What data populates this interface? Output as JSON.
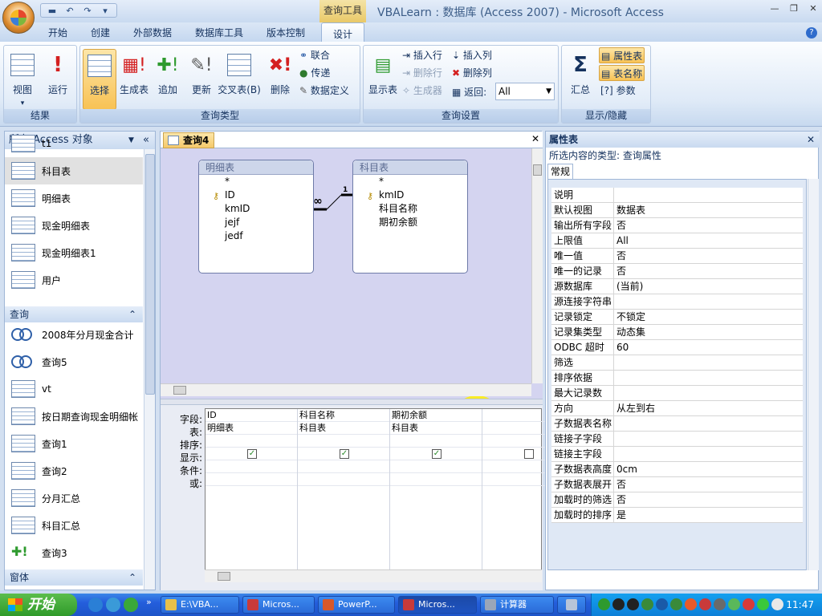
{
  "window": {
    "context_tab": "查询工具",
    "title": "VBALearn : 数据库 (Access 2007) - Microsoft Access"
  },
  "tabs": [
    "开始",
    "创建",
    "外部数据",
    "数据库工具",
    "版本控制",
    "设计"
  ],
  "ribbon": {
    "groups": {
      "results": "结果",
      "query_type": "查询类型",
      "query_setup": "查询设置",
      "show_hide": "显示/隐藏"
    },
    "results": {
      "view": "视图",
      "run": "运行"
    },
    "query_type": {
      "select": "选择",
      "make_table": "生成表",
      "append": "追加",
      "update": "更新",
      "crosstab": "交叉表(B)",
      "delete": "删除",
      "union": "联合",
      "passthrough": "传递",
      "data_definition": "数据定义"
    },
    "query_setup": {
      "show_table": "显示表",
      "insert_rows": "插入行",
      "delete_rows": "删除行",
      "builder": "生成器",
      "insert_columns": "插入列",
      "delete_columns": "删除列",
      "return_label": "返回:",
      "return_value": "All"
    },
    "show_hide": {
      "totals": "汇总",
      "property_sheet": "属性表",
      "table_names": "表名称",
      "parameters": "参数"
    }
  },
  "nav": {
    "header": "所有 Access 对象",
    "tables": [
      "t1",
      "科目表",
      "明细表",
      "现金明细表",
      "现金明细表1",
      "用户"
    ],
    "selected_table": 1,
    "queries_section": "查询",
    "queries": [
      "2008年分月现金合计",
      "查询5",
      "vt",
      "按日期查询现金明细帐",
      "查询1",
      "查询2",
      "分月汇总",
      "科目汇总",
      "查询3"
    ],
    "forms_section": "窗体"
  },
  "query": {
    "tab_label": "查询4",
    "tables": [
      {
        "name": "明细表",
        "fields": [
          "*",
          "ID",
          "kmID",
          "jejf",
          "jedf"
        ],
        "key": 1
      },
      {
        "name": "科目表",
        "fields": [
          "*",
          "kmID",
          "科目名称",
          "期初余额"
        ],
        "key": 1
      }
    ],
    "join": {
      "left_symbol": "∞",
      "right_symbol": "1"
    },
    "grid": {
      "row_labels": [
        "字段:",
        "表:",
        "排序:",
        "显示:",
        "条件:",
        "或:"
      ],
      "columns": [
        {
          "field": "ID",
          "table": "明细表",
          "show": true
        },
        {
          "field": "科目名称",
          "table": "科目表",
          "show": true
        },
        {
          "field": "期初余额",
          "table": "科目表",
          "show": true
        },
        {
          "field": "",
          "table": "",
          "show": false
        }
      ]
    }
  },
  "props": {
    "header": "属性表",
    "selection_label": "所选内容的类型: 查询属性",
    "tab": "常规",
    "rows": [
      [
        "说明",
        ""
      ],
      [
        "默认视图",
        "数据表"
      ],
      [
        "输出所有字段",
        "否"
      ],
      [
        "上限值",
        "All"
      ],
      [
        "唯一值",
        "否"
      ],
      [
        "唯一的记录",
        "否"
      ],
      [
        "源数据库",
        "(当前)"
      ],
      [
        "源连接字符串",
        ""
      ],
      [
        "记录锁定",
        "不锁定"
      ],
      [
        "记录集类型",
        "动态集"
      ],
      [
        "ODBC 超时",
        "60"
      ],
      [
        "筛选",
        ""
      ],
      [
        "排序依据",
        ""
      ],
      [
        "最大记录数",
        ""
      ],
      [
        "方向",
        "从左到右"
      ],
      [
        "子数据表名称",
        ""
      ],
      [
        "链接子字段",
        ""
      ],
      [
        "链接主字段",
        ""
      ],
      [
        "子数据表高度",
        "0cm"
      ],
      [
        "子数据表展开",
        "否"
      ],
      [
        "加载时的筛选",
        "否"
      ],
      [
        "加载时的排序",
        "是"
      ]
    ]
  },
  "taskbar": {
    "start": "开始",
    "tasks": [
      "E:\\VBA...",
      "Micros...",
      "PowerP...",
      "Micros...",
      "计算器",
      ""
    ],
    "clock": "11:47"
  },
  "colors": {
    "accent": "#f8c254",
    "ribbon": "#dfeaf7",
    "taskbar": "#245edc"
  }
}
